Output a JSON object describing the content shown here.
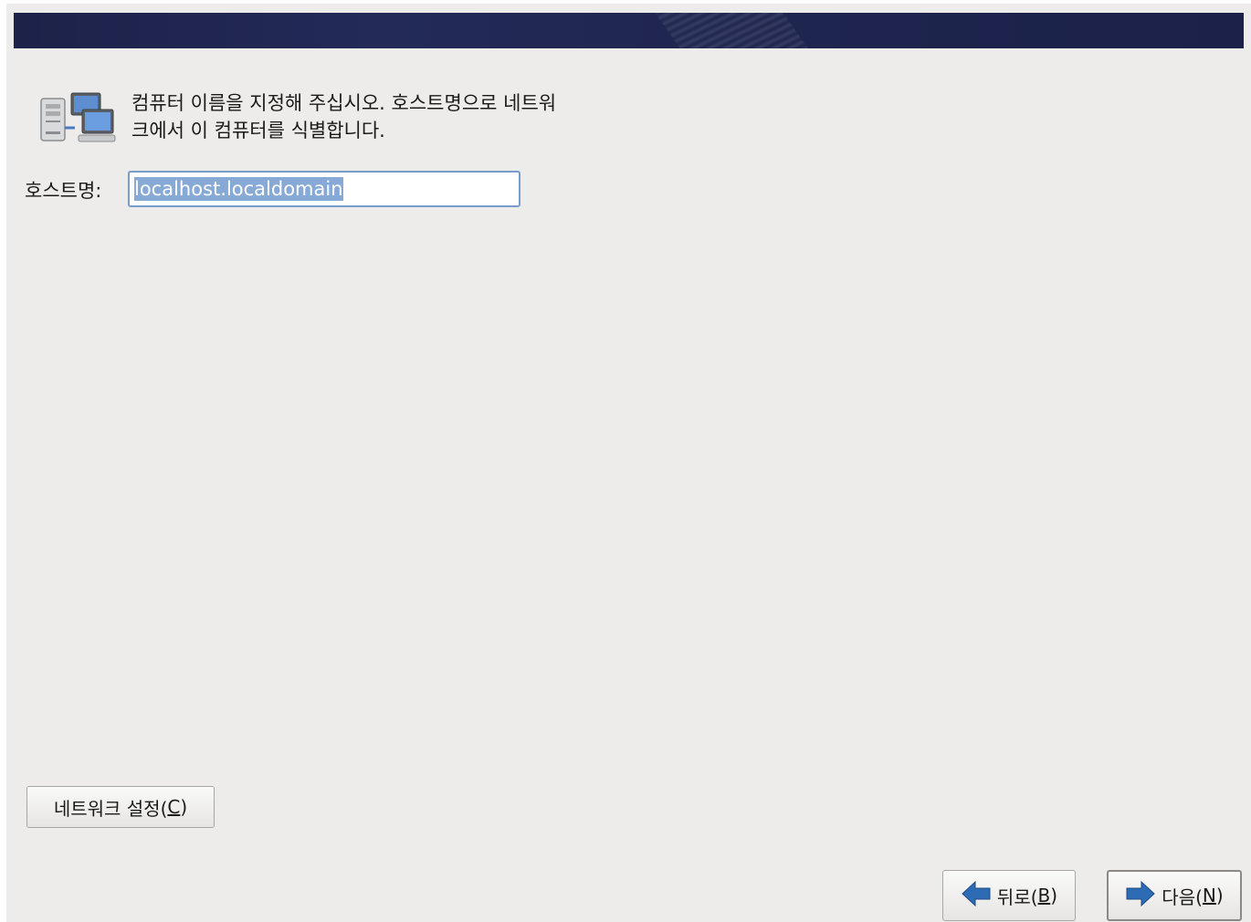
{
  "banner": {},
  "intro": {
    "icon": "network-computers-icon",
    "text_line1": "컴퓨터 이름을 지정해 주십시오. 호스트명으로 네트워",
    "text_line2": "크에서 이 컴퓨터를 식별합니다."
  },
  "hostname": {
    "label": "호스트명:",
    "value": "localhost.localdomain"
  },
  "buttons": {
    "network_pre": "네트워크 설정(",
    "network_mnemonic": "C",
    "network_post": ")",
    "back_pre": "뒤로(",
    "back_mnemonic": "B",
    "back_post": ")",
    "next_pre": "다음(",
    "next_mnemonic": "N",
    "next_post": ")"
  },
  "colors": {
    "banner": "#1d2249",
    "selection": "#86a9d6",
    "arrow": "#2d6bb5"
  }
}
